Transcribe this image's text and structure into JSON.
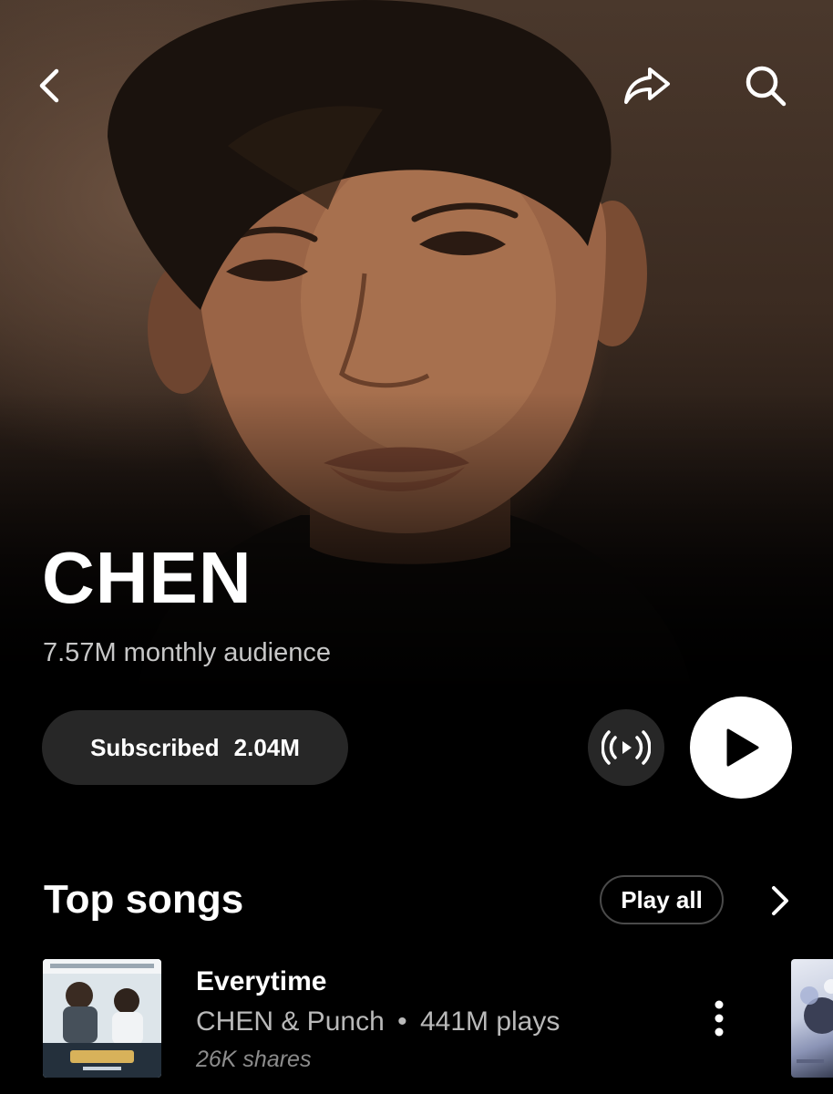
{
  "artist": {
    "name": "CHEN",
    "monthly_audience": "7.57M monthly audience"
  },
  "actions": {
    "subscribe_label": "Subscribed",
    "subscriber_count": "2.04M"
  },
  "top_songs": {
    "title": "Top songs",
    "play_all_label": "Play all",
    "items": [
      {
        "title": "Everytime",
        "artists": "CHEN & Punch",
        "separator": "•",
        "plays": "441M plays",
        "shares": "26K shares"
      }
    ]
  },
  "icons": {
    "back": "back-chevron-icon",
    "share": "share-arrow-icon",
    "search": "search-icon",
    "radio": "radio-broadcast-icon",
    "play": "play-icon",
    "more": "more-vertical-icon",
    "section_next": "chevron-right-icon"
  },
  "colors": {
    "background": "#000000",
    "pill": "#272727",
    "play_button": "#ffffff"
  }
}
